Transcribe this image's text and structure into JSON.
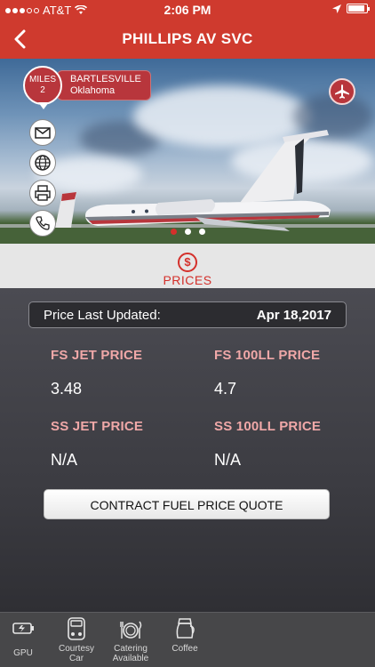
{
  "status_bar": {
    "carrier": "AT&T",
    "time": "2:06 PM",
    "wifi_icon": "wifi-icon",
    "location_icon": "location-arrow-icon",
    "battery_level": 0.9
  },
  "nav": {
    "title": "PHILLIPS AV SVC",
    "back_icon": "chevron-left-icon"
  },
  "hero": {
    "miles_label": "MILES",
    "miles_value": "2",
    "city": "BARTLESVILLE",
    "state": "Oklahoma",
    "actions": [
      "email-icon",
      "globe-icon",
      "fax-icon",
      "phone-icon"
    ],
    "carousel_pages": 3,
    "carousel_active": 0
  },
  "prices_tab": {
    "icon_symbol": "$",
    "label": "PRICES"
  },
  "prices": {
    "updated_label": "Price Last Updated:",
    "updated_date": "Apr 18,2017",
    "fs_jet_label": "FS JET PRICE",
    "fs_jet_value": "3.48",
    "fs_100ll_label": "FS 100LL PRICE",
    "fs_100ll_value": "4.7",
    "ss_jet_label": "SS JET PRICE",
    "ss_jet_value": "N/A",
    "ss_100ll_label": "SS 100LL PRICE",
    "ss_100ll_value": "N/A",
    "quote_button": "CONTRACT FUEL PRICE QUOTE"
  },
  "amenities": [
    {
      "line1": "GPU",
      "line2": ""
    },
    {
      "line1": "Courtesy",
      "line2": "Car"
    },
    {
      "line1": "Catering",
      "line2": "Available"
    },
    {
      "line1": "Coffee",
      "line2": ""
    }
  ],
  "colors": {
    "brand_red": "#cf3a2e",
    "price_label": "#f0a8a8",
    "accent_red": "#d4302b"
  }
}
